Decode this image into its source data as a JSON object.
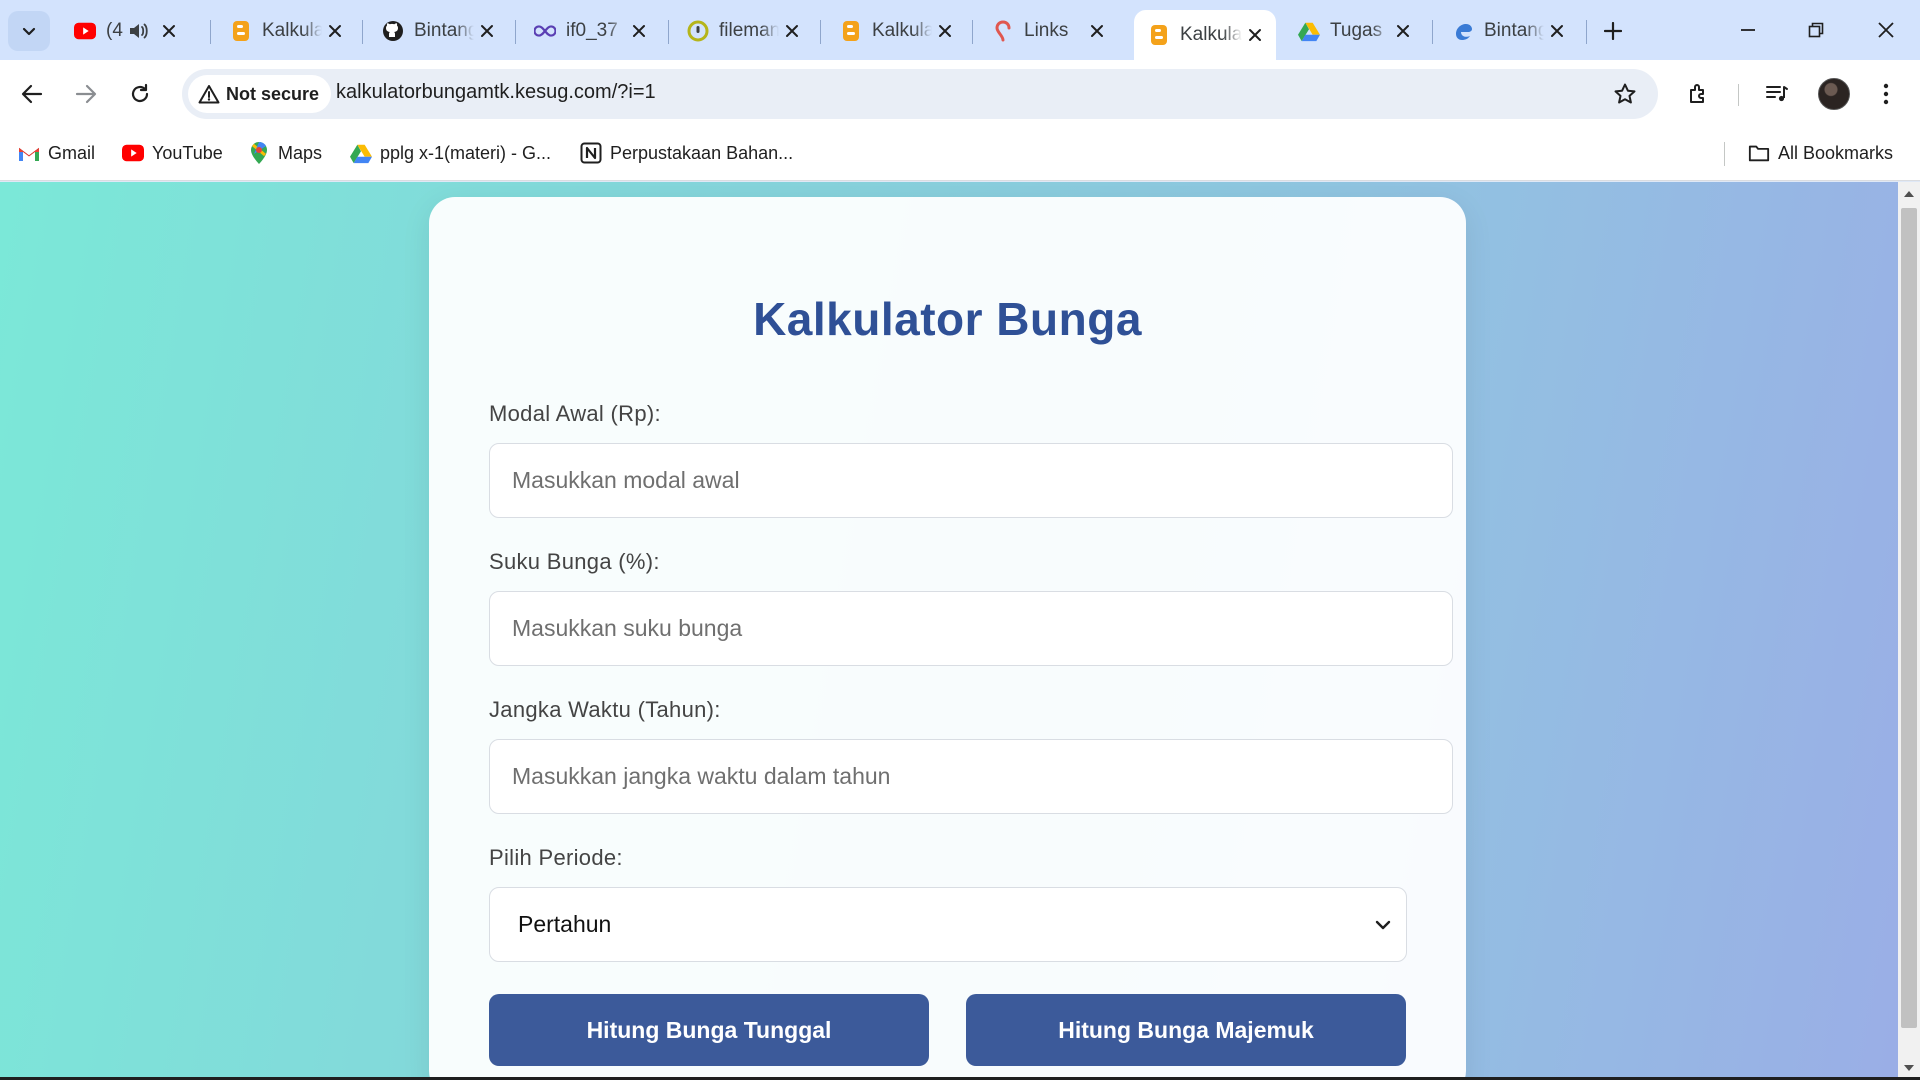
{
  "browser": {
    "tabs": [
      {
        "title": "(4",
        "icon": "youtube-icon",
        "audio": true
      },
      {
        "title": "Kalkulator Bunga",
        "icon": "blogger-icon"
      },
      {
        "title": "BintangMTK",
        "icon": "github-icon"
      },
      {
        "title": "if0_37",
        "icon": "infinityfree-icon"
      },
      {
        "title": "filemanager",
        "icon": "filemanager-icon"
      },
      {
        "title": "Kalkulator Bunga",
        "icon": "blogger-icon"
      },
      {
        "title": "Links",
        "icon": "links-icon"
      },
      {
        "title": "Kalkulator Bunga",
        "icon": "blogger-icon",
        "active": true
      },
      {
        "title": "Tugas",
        "icon": "google-drive-icon"
      },
      {
        "title": "BintangMTK",
        "icon": "edge-icon"
      }
    ],
    "address": {
      "security_label": "Not secure",
      "url": "kalkulatorbungamtk.kesug.com/?i=1"
    },
    "bookmarks": [
      {
        "label": "Gmail",
        "icon": "gmail-icon"
      },
      {
        "label": "YouTube",
        "icon": "youtube-icon"
      },
      {
        "label": "Maps",
        "icon": "maps-icon"
      },
      {
        "label": "pplg x-1(materi) - G...",
        "icon": "google-drive-icon"
      },
      {
        "label": "Perpustakaan Bahan...",
        "icon": "notion-icon"
      }
    ],
    "all_bookmarks": "All Bookmarks"
  },
  "page": {
    "title": "Kalkulator Bunga",
    "fields": [
      {
        "label": "Modal Awal (Rp):",
        "placeholder": "Masukkan modal awal"
      },
      {
        "label": "Suku Bunga (%):",
        "placeholder": "Masukkan suku bunga"
      },
      {
        "label": "Jangka Waktu (Tahun):",
        "placeholder": "Masukkan jangka waktu dalam tahun"
      }
    ],
    "period": {
      "label": "Pilih Periode:",
      "selected": "Pertahun"
    },
    "buttons": {
      "simple": "Hitung Bunga Tunggal",
      "compound": "Hitung Bunga Majemuk"
    }
  },
  "colors": {
    "heading": "#2f5096",
    "button": "#3c5a9a",
    "tabstrip": "#d3e3fd",
    "background_start": "#7be8d8",
    "background_end": "#9aaee6"
  }
}
